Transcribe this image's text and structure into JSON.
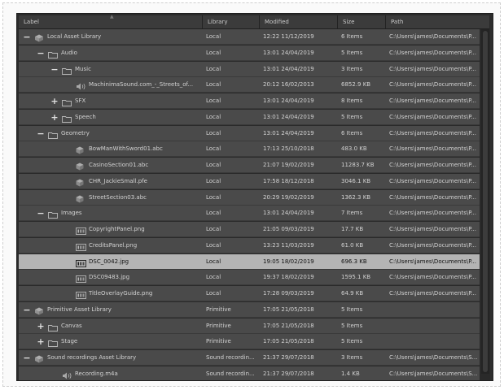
{
  "columns": [
    "Label",
    "Library",
    "Modified",
    "Size",
    "Path"
  ],
  "rows": [
    {
      "label": "Local Asset Library",
      "library": "Local",
      "modified": "12:22  11/12/2019",
      "size": "6 Items",
      "path": "C:\\Users\\james\\Documents\\P...",
      "icon": "library-icon",
      "expander": "−",
      "depth": 0
    },
    {
      "label": "Audio",
      "library": "Local",
      "modified": "13:01  24/04/2019",
      "size": "5 Items",
      "path": "C:\\Users\\james\\Documents\\P...",
      "icon": "folder-icon",
      "expander": "−",
      "depth": 1
    },
    {
      "label": "Music",
      "library": "Local",
      "modified": "13:01  24/04/2019",
      "size": "3 Items",
      "path": "C:\\Users\\james\\Documents\\P...",
      "icon": "folder-icon",
      "expander": "−",
      "depth": 2
    },
    {
      "label": "MachinimaSound.com_-_Streets_of...",
      "library": "Local",
      "modified": "20:12  16/02/2013",
      "size": "6852.9 KB",
      "path": "C:\\Users\\james\\Documents\\P...",
      "icon": "audio-icon",
      "expander": "",
      "depth": 3
    },
    {
      "label": "SFX",
      "library": "Local",
      "modified": "13:01  24/04/2019",
      "size": "8 Items",
      "path": "C:\\Users\\james\\Documents\\P...",
      "icon": "folder-icon",
      "expander": "+",
      "depth": 2
    },
    {
      "label": "Speech",
      "library": "Local",
      "modified": "13:01  24/04/2019",
      "size": "5 Items",
      "path": "C:\\Users\\james\\Documents\\P...",
      "icon": "folder-icon",
      "expander": "+",
      "depth": 2
    },
    {
      "label": "Geometry",
      "library": "Local",
      "modified": "13:01  24/04/2019",
      "size": "6 Items",
      "path": "C:\\Users\\james\\Documents\\P...",
      "icon": "folder-icon",
      "expander": "−",
      "depth": 1
    },
    {
      "label": "BowManWithSword01.abc",
      "library": "Local",
      "modified": "17:13  25/10/2018",
      "size": "483.0 KB",
      "path": "C:\\Users\\james\\Documents\\P...",
      "icon": "geometry-icon",
      "expander": "",
      "depth": 3
    },
    {
      "label": "CasinoSection01.abc",
      "library": "Local",
      "modified": "21:07  19/02/2019",
      "size": "11283.7 KB",
      "path": "C:\\Users\\james\\Documents\\P...",
      "icon": "geometry-icon",
      "expander": "",
      "depth": 3
    },
    {
      "label": "CHR_JackieSmall.pfe",
      "library": "Local",
      "modified": "17:58  18/12/2018",
      "size": "3046.1 KB",
      "path": "C:\\Users\\james\\Documents\\P...",
      "icon": "geometry-icon",
      "expander": "",
      "depth": 3
    },
    {
      "label": "StreetSection03.abc",
      "library": "Local",
      "modified": "20:29  19/02/2019",
      "size": "1362.3 KB",
      "path": "C:\\Users\\james\\Documents\\P...",
      "icon": "geometry-icon",
      "expander": "",
      "depth": 3
    },
    {
      "label": "Images",
      "library": "Local",
      "modified": "13:01  24/04/2019",
      "size": "7 Items",
      "path": "C:\\Users\\james\\Documents\\P...",
      "icon": "folder-icon",
      "expander": "−",
      "depth": 1
    },
    {
      "label": "CopyrightPanel.png",
      "library": "Local",
      "modified": "21:05  09/03/2019",
      "size": "17.7 KB",
      "path": "C:\\Users\\james\\Documents\\P...",
      "icon": "image-icon",
      "expander": "",
      "depth": 3
    },
    {
      "label": "CreditsPanel.png",
      "library": "Local",
      "modified": "13:23  11/03/2019",
      "size": "61.0 KB",
      "path": "C:\\Users\\james\\Documents\\P...",
      "icon": "image-icon",
      "expander": "",
      "depth": 3
    },
    {
      "label": "DSC_0042.jpg",
      "library": "Local",
      "modified": "19:05  18/02/2019",
      "size": "696.3 KB",
      "path": "C:\\Users\\james\\Documents\\P...",
      "icon": "image-icon",
      "expander": "",
      "depth": 3,
      "selected": true
    },
    {
      "label": "DSC09483.jpg",
      "library": "Local",
      "modified": "19:37  18/02/2019",
      "size": "1595.1 KB",
      "path": "C:\\Users\\james\\Documents\\P...",
      "icon": "image-icon",
      "expander": "",
      "depth": 3
    },
    {
      "label": "TitleOverlayGuide.png",
      "library": "Local",
      "modified": "17:28  09/03/2019",
      "size": "64.9 KB",
      "path": "C:\\Users\\james\\Documents\\P...",
      "icon": "image-icon",
      "expander": "",
      "depth": 3
    },
    {
      "label": "Primitive Asset Library",
      "library": "Primitive",
      "modified": "17:05  21/05/2018",
      "size": "5 Items",
      "path": "",
      "icon": "library-icon",
      "expander": "−",
      "depth": 0
    },
    {
      "label": "Canvas",
      "library": "Primitive",
      "modified": "17:05  21/05/2018",
      "size": "5 Items",
      "path": "",
      "icon": "folder-icon",
      "expander": "+",
      "depth": 1
    },
    {
      "label": "Stage",
      "library": "Primitive",
      "modified": "17:05  21/05/2018",
      "size": "5 Items",
      "path": "",
      "icon": "folder-icon",
      "expander": "+",
      "depth": 1
    },
    {
      "label": "Sound recordings Asset Library",
      "library": "Sound recordin...",
      "modified": "21:37  29/07/2018",
      "size": "3 Items",
      "path": "C:\\Users\\james\\Documents\\S...",
      "icon": "library-icon",
      "expander": "−",
      "depth": 0
    },
    {
      "label": "Recording.m4a",
      "library": "Sound recordin...",
      "modified": "21:37  29/07/2018",
      "size": "1.4 KB",
      "path": "C:\\Users\\james\\Documents\\S...",
      "icon": "audio-icon",
      "expander": "",
      "depth": 2
    }
  ]
}
